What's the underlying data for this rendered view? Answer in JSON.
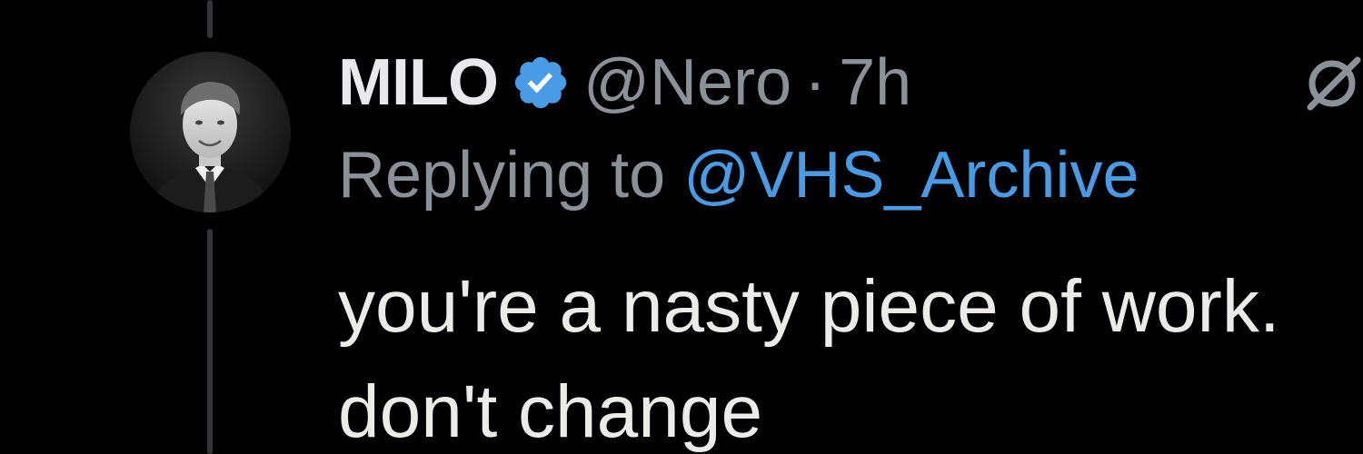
{
  "tweet": {
    "author": {
      "display_name": "MILO",
      "handle": "@Nero",
      "verified": true,
      "verified_color": "#4a9be6",
      "avatar_icon": "profile-photo"
    },
    "separator": "·",
    "timestamp": "7h",
    "replying_prefix": "Replying to",
    "replying_to": "@VHS_Archive",
    "text_lines": [
      "you're a nasty piece of work.",
      "don't change"
    ],
    "menu_icon": "grok-icon"
  },
  "colors": {
    "background": "#000000",
    "primary_text": "#e7e9ea",
    "secondary_text": "#8b9198",
    "link": "#4a9be6",
    "thread_line": "#333639"
  }
}
